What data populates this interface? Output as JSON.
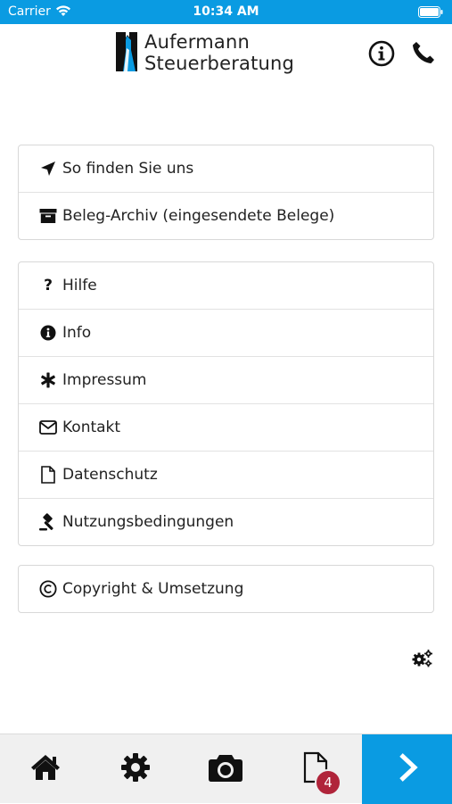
{
  "status_bar": {
    "carrier": "Carrier",
    "time": "10:34 AM"
  },
  "brand": {
    "line1": "Aufermann",
    "line2": "Steuerberatung",
    "accent_color": "#0a9be2"
  },
  "header_icons": [
    "info-icon",
    "phone-icon"
  ],
  "menu": {
    "group1": [
      {
        "label": "So finden Sie uns",
        "icon": "location-arrow-icon"
      },
      {
        "label": "Beleg-Archiv (eingesendete Belege)",
        "icon": "archive-box-icon"
      }
    ],
    "group2": [
      {
        "label": "Hilfe",
        "icon": "question-icon"
      },
      {
        "label": "Info",
        "icon": "info-circle-icon"
      },
      {
        "label": "Impressum",
        "icon": "asterisk-icon"
      },
      {
        "label": "Kontakt",
        "icon": "envelope-icon"
      },
      {
        "label": "Datenschutz",
        "icon": "document-icon"
      },
      {
        "label": "Nutzungsbedingungen",
        "icon": "gavel-icon"
      }
    ],
    "group3": [
      {
        "label": "Copyright & Umsetzung",
        "icon": "copyright-icon"
      }
    ]
  },
  "tab_bar": {
    "tabs": [
      "home-icon",
      "settings-gear-icon",
      "camera-icon",
      "documents-icon",
      "next-arrow-icon"
    ],
    "documents_badge": "4",
    "badge_color": "#b0243a"
  }
}
